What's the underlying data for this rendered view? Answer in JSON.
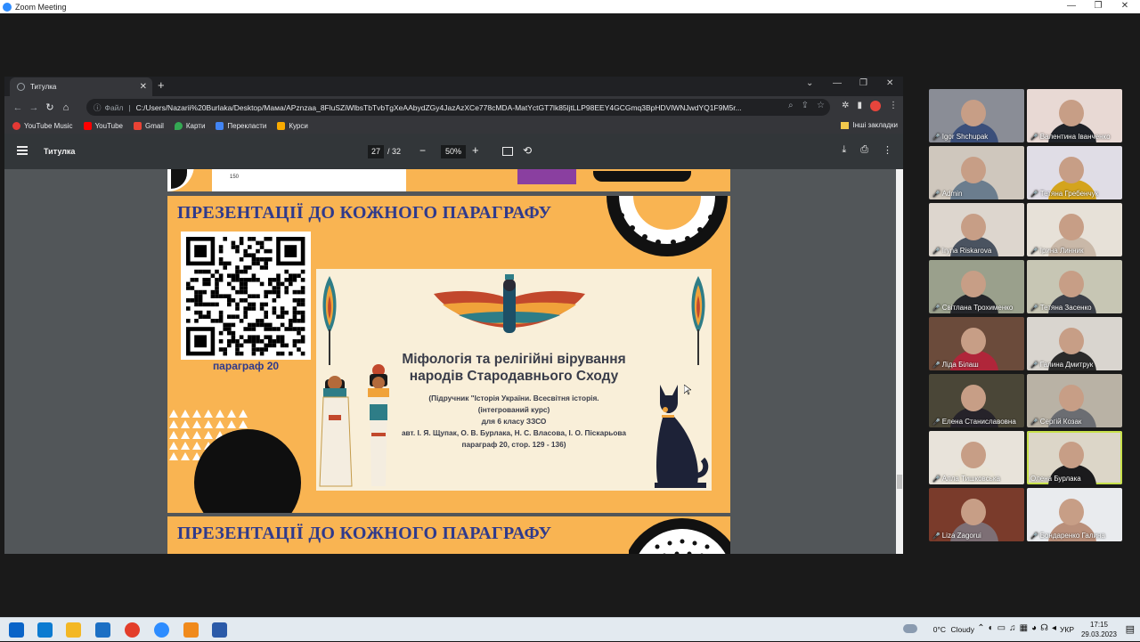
{
  "zoom": {
    "title": "Zoom Meeting",
    "min": "—",
    "max": "❐",
    "close": "✕"
  },
  "browser": {
    "tab_title": "Титулка",
    "tab_close": "✕",
    "new_tab": "+",
    "address_label": "Файл",
    "address_url": "C:/Users/Nazarii%20Burlaka/Desktop/Мама/APznzaa_8FluSZiWlbsTbTvbTgXeAAbydZGy4JazAzXCe778cMDA-MatYctGT7lk85ljtLLP98EEY4GCGmq3BpHDVlWNJwdYQ1F9M5r...",
    "nav": {
      "back": "←",
      "forward": "→",
      "reload": "↻",
      "home": "⌂"
    },
    "bookmarks": [
      {
        "label": "YouTube Music",
        "color": "#e53935"
      },
      {
        "label": "YouTube",
        "color": "#ff0000"
      },
      {
        "label": "Gmail",
        "color": "#ea4335"
      },
      {
        "label": "Карти",
        "color": "#34a853"
      },
      {
        "label": "Перекласти",
        "color": "#4285f4"
      },
      {
        "label": "Курси",
        "color": "#f9ab00"
      }
    ],
    "other_bookmarks": "Інші закладки"
  },
  "pdf": {
    "title": "Титулка",
    "page": "27",
    "page_total": "/ 32",
    "zoom": "50%",
    "zoom_minus": "−",
    "zoom_plus": "+",
    "download": "⤓",
    "print": "⎙",
    "more": "⋮",
    "prev_slide_fragment": "150",
    "slide": {
      "title": "ПРЕЗЕНТАЦІЇ ДО КОЖНОГО ПАРАГРАФУ",
      "qr_caption": "параграф 20",
      "card_title_line1": "Міфологія та релігійні вірування",
      "card_title_line2": "народів Стародавнього Сходу",
      "card_body": [
        "(Підручник \"Історія України. Всесвітня історія.",
        "(інтегрований курс)",
        "для 6 класу ЗЗСО",
        "авт. І. Я. Щупак, О. В. Бурлака, Н. С. Власова, І. О. Піскарьова",
        "параграф 20, стор. 129 - 136)"
      ]
    },
    "next_slide_title": "ПРЕЗЕНТАЦІЇ ДО КОЖНОГО ПАРАГРАФУ"
  },
  "participants": [
    {
      "name": "Igor Shchupak",
      "bg": "#8a8d96",
      "shirt": "#3b4f7a"
    },
    {
      "name": "Валентина Іванченко",
      "bg": "#e8d9d4",
      "shirt": "#1f2228"
    },
    {
      "name": "Admin",
      "bg": "#cfc7bd",
      "shirt": "#6b7d8e"
    },
    {
      "name": "Тетяна Гребенчук",
      "bg": "#e0dde6",
      "shirt": "#d4a41d"
    },
    {
      "name": "Iryna Riskarova",
      "bg": "#ddd6ce",
      "shirt": "#4a5360"
    },
    {
      "name": "Ірина Линник",
      "bg": "#e7e1d8",
      "shirt": "#c9b8a8"
    },
    {
      "name": "Світлана Трохименко",
      "bg": "#9aa08c",
      "shirt": "#24262a"
    },
    {
      "name": "Тетяна Засенко",
      "bg": "#c7c6b4",
      "shirt": "#3b3f48"
    },
    {
      "name": "Ліда Білаш",
      "bg": "#6b4b3b",
      "shirt": "#b0263a"
    },
    {
      "name": "Галина Дмитрук",
      "bg": "#d9d5cf",
      "shirt": "#2a2a2a"
    },
    {
      "name": "Елена Станиславовна",
      "bg": "#4a4637",
      "shirt": "#26232a"
    },
    {
      "name": "Сергій Козак",
      "bg": "#b9b2a5",
      "shirt": "#6b6d72"
    },
    {
      "name": "Алла Тишковська",
      "bg": "#e8e3da",
      "shirt": "#e8e3d6"
    },
    {
      "name": "Олена Бурлака",
      "bg": "#dcd6c8",
      "shirt": "#1b1b1d"
    },
    {
      "name": "Liza Zagorui",
      "bg": "#7a3b2b",
      "shirt": "#7d6f75"
    },
    {
      "name": "Бондаренко Галина",
      "bg": "#e9ebee",
      "shirt": "#b98f7a"
    }
  ],
  "taskbar": {
    "weather_temp": "0°C",
    "weather_text": "Cloudy",
    "lang": "УКР",
    "time": "17:15",
    "date": "29.03.2023",
    "apps": [
      {
        "name": "start",
        "color": "#0a64c8"
      },
      {
        "name": "edge",
        "color": "#0c7bd1"
      },
      {
        "name": "explorer",
        "color": "#f3b724"
      },
      {
        "name": "mail",
        "color": "#1b6fc4"
      },
      {
        "name": "chrome",
        "color": "#e33e2b"
      },
      {
        "name": "zoom",
        "color": "#2D8CFF"
      },
      {
        "name": "vlc",
        "color": "#f08a1c"
      },
      {
        "name": "word",
        "color": "#2b5aa8"
      }
    ]
  }
}
